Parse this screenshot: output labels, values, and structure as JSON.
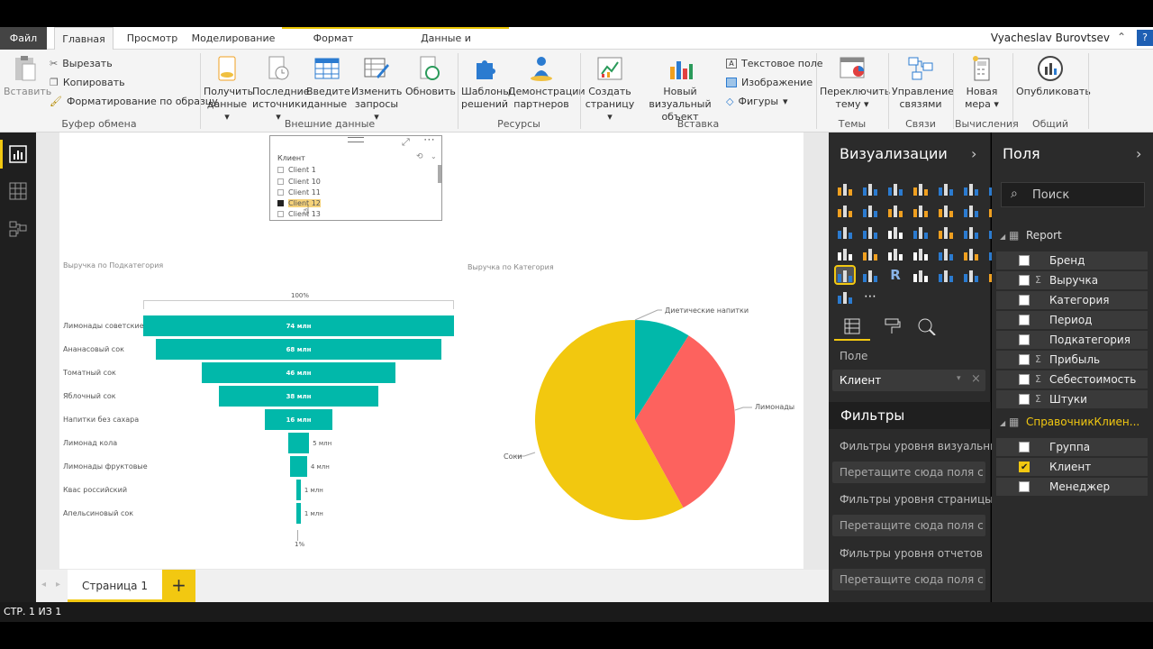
{
  "tabs": {
    "file": "Файл",
    "home": "Главная",
    "view": "Просмотр",
    "modeling": "Моделирование",
    "format": "Формат",
    "data": "Данные и детализация"
  },
  "user": "Vyacheslav Burovtsev",
  "ribbon": {
    "paste": "Вставить",
    "cut": "Вырезать",
    "copy": "Копировать",
    "format_painter": "Форматирование по образцу",
    "clipboard_group": "Буфер обмена",
    "get_data_1": "Получить",
    "get_data_2": "данные",
    "recent_1": "Последние",
    "recent_2": "источники",
    "enter_1": "Введите",
    "enter_2": "данные",
    "edit_1": "Изменить",
    "edit_2": "запросы",
    "refresh": "Обновить",
    "external_group": "Внешние данные",
    "templates_1": "Шаблоны",
    "templates_2": "решений",
    "partners_1": "Демонстрации",
    "partners_2": "партнеров",
    "resources_group": "Ресурсы",
    "newpage_1": "Создать",
    "newpage_2": "страницу",
    "newvisual_1": "Новый визуальный",
    "newvisual_2": "объект",
    "textbox": "Текстовое поле",
    "image": "Изображение",
    "shapes": "Фигуры",
    "insert_group": "Вставка",
    "theme_1": "Переключить",
    "theme_2": "тему",
    "themes_group": "Темы",
    "rel_1": "Управление",
    "rel_2": "связями",
    "rel_group": "Связи",
    "measure_1": "Новая",
    "measure_2": "мера",
    "calc_group": "Вычисления",
    "publish": "Опубликовать",
    "share_group": "Общий доступ"
  },
  "slicer": {
    "title": "Клиент",
    "items": [
      "Client 1",
      "Client 10",
      "Client 11",
      "Client 12",
      "Client 13"
    ],
    "selected": "Client 12"
  },
  "funnel": {
    "title": "Выручка по Подкатегория",
    "top_pct": "100%",
    "bottom_pct": "1%",
    "categories": [
      "Лимонады советские",
      "Ананасовый сок",
      "Томатный сок",
      "Яблочный сок",
      "Напитки без сахара",
      "Лимонад кола",
      "Лимонады фруктовые",
      "Квас российский",
      "Апельсиновый сок"
    ],
    "labels": [
      "74 млн",
      "68 млн",
      "46 млн",
      "38 млн",
      "16 млн",
      "5 млн",
      "4 млн",
      "1 млн",
      "1 млн"
    ]
  },
  "pie": {
    "title": "Выручка по Категория",
    "labels": {
      "diet": "Диетические напитки",
      "lemonades": "Лимонады",
      "juices": "Соки"
    }
  },
  "chart_data": [
    {
      "type": "bar",
      "title": "Выручка по Подкатегория",
      "categories": [
        "Лимонады советские",
        "Ананасовый сок",
        "Томатный сок",
        "Яблочный сок",
        "Напитки без сахара",
        "Лимонад кола",
        "Лимонады фруктовые",
        "Квас российский",
        "Апельсиновый сок"
      ],
      "values": [
        74,
        68,
        46,
        38,
        16,
        5,
        4,
        1,
        1
      ],
      "unit": "млн",
      "colors": [
        "#01b8aa"
      ]
    },
    {
      "type": "pie",
      "title": "Выручка по Категория",
      "categories": [
        "Диетические напитки",
        "Лимонады",
        "Соки"
      ],
      "values": [
        9,
        33,
        58
      ],
      "colors": [
        "#01b8aa",
        "#fd625e",
        "#f2c80f"
      ]
    }
  ],
  "pagetab": "Страница 1",
  "add": "+",
  "status": "СТР. 1 ИЗ 1",
  "viz": {
    "title": "Визуализации",
    "field_label": "Поле",
    "field_value": "Клиент",
    "filters_title": "Фильтры",
    "vis_filters": "Фильтры уровня визуальны...",
    "page_filters": "Фильтры уровня страницы",
    "report_filters": "Фильтры уровня отчетов",
    "drop": "Перетащите сюда поля с ..."
  },
  "fields": {
    "title": "Поля",
    "search": "Поиск",
    "table1": "Report",
    "table2": "СправочникКлиен...",
    "items1": [
      {
        "name": "Бренд",
        "sigma": false
      },
      {
        "name": "Выручка",
        "sigma": true
      },
      {
        "name": "Категория",
        "sigma": false
      },
      {
        "name": "Период",
        "sigma": false
      },
      {
        "name": "Подкатегория",
        "sigma": false
      },
      {
        "name": "Прибыль",
        "sigma": true
      },
      {
        "name": "Себестоимость",
        "sigma": true
      },
      {
        "name": "Штуки",
        "sigma": true
      }
    ],
    "items2": [
      {
        "name": "Группа",
        "checked": false
      },
      {
        "name": "Клиент",
        "checked": true
      },
      {
        "name": "Менеджер",
        "checked": false
      }
    ]
  }
}
